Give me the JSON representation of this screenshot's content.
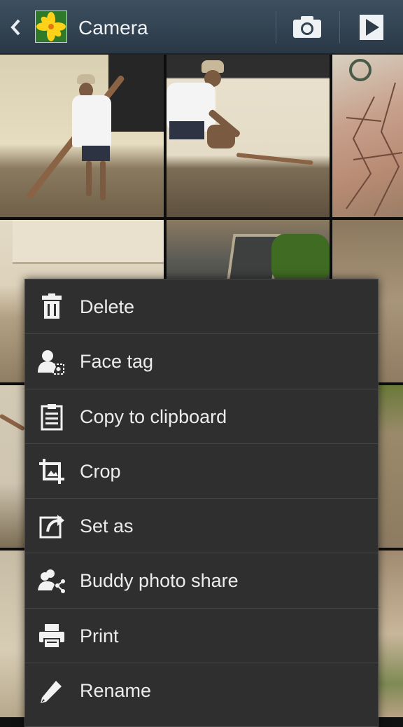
{
  "action_bar": {
    "title": "Camera",
    "back_icon": "chevron-left-icon",
    "album_icon": "flower-thumbnail-icon",
    "camera_icon": "camera-icon",
    "slideshow_icon": "play-icon",
    "background_color": "#33424f"
  },
  "grid": {
    "tiles": [
      "photo",
      "photo",
      "photo",
      "photo",
      "photo",
      "photo",
      "photo",
      "photo",
      "photo",
      "photo"
    ]
  },
  "menu": {
    "background_color": "#2f2f2f",
    "items": [
      {
        "label": "Delete",
        "icon": "trash-icon"
      },
      {
        "label": "Face tag",
        "icon": "face-tag-icon"
      },
      {
        "label": "Copy to clipboard",
        "icon": "clipboard-icon"
      },
      {
        "label": "Crop",
        "icon": "crop-icon"
      },
      {
        "label": "Set as",
        "icon": "set-as-icon"
      },
      {
        "label": "Buddy photo share",
        "icon": "buddy-share-icon"
      },
      {
        "label": "Print",
        "icon": "print-icon"
      },
      {
        "label": "Rename",
        "icon": "pencil-icon"
      }
    ]
  }
}
